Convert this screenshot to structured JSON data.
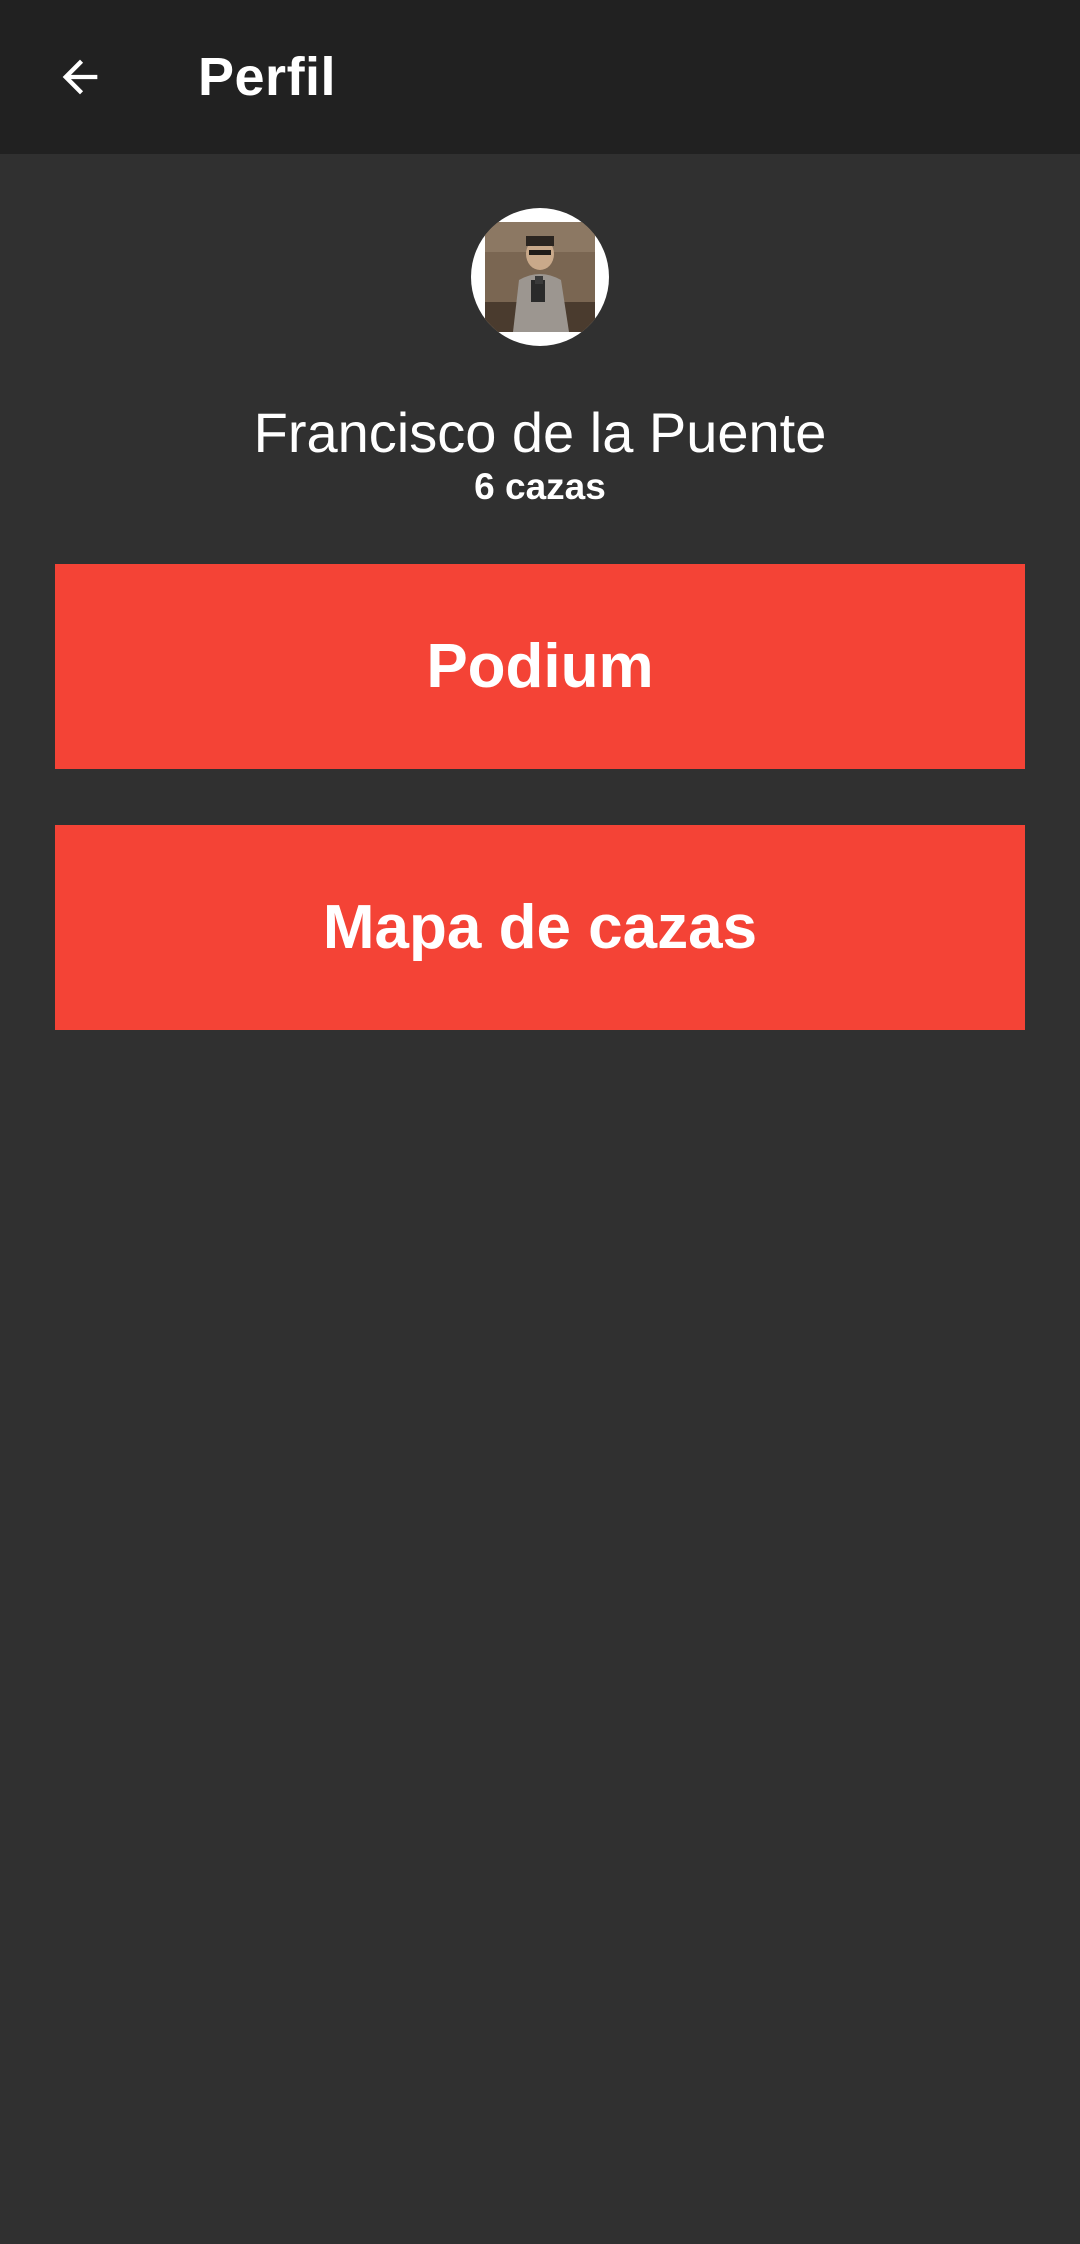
{
  "app_bar": {
    "title": "Perfil",
    "back_icon": "arrow-back-icon"
  },
  "profile": {
    "avatar_icon": "user-avatar",
    "name": "Francisco de la Puente",
    "count": "6 cazas"
  },
  "actions": {
    "podium_label": "Podium",
    "mapa_label": "Mapa de cazas"
  },
  "colors": {
    "background": "#303030",
    "app_bar": "#212121",
    "accent": "#f44336",
    "text": "#ffffff"
  }
}
